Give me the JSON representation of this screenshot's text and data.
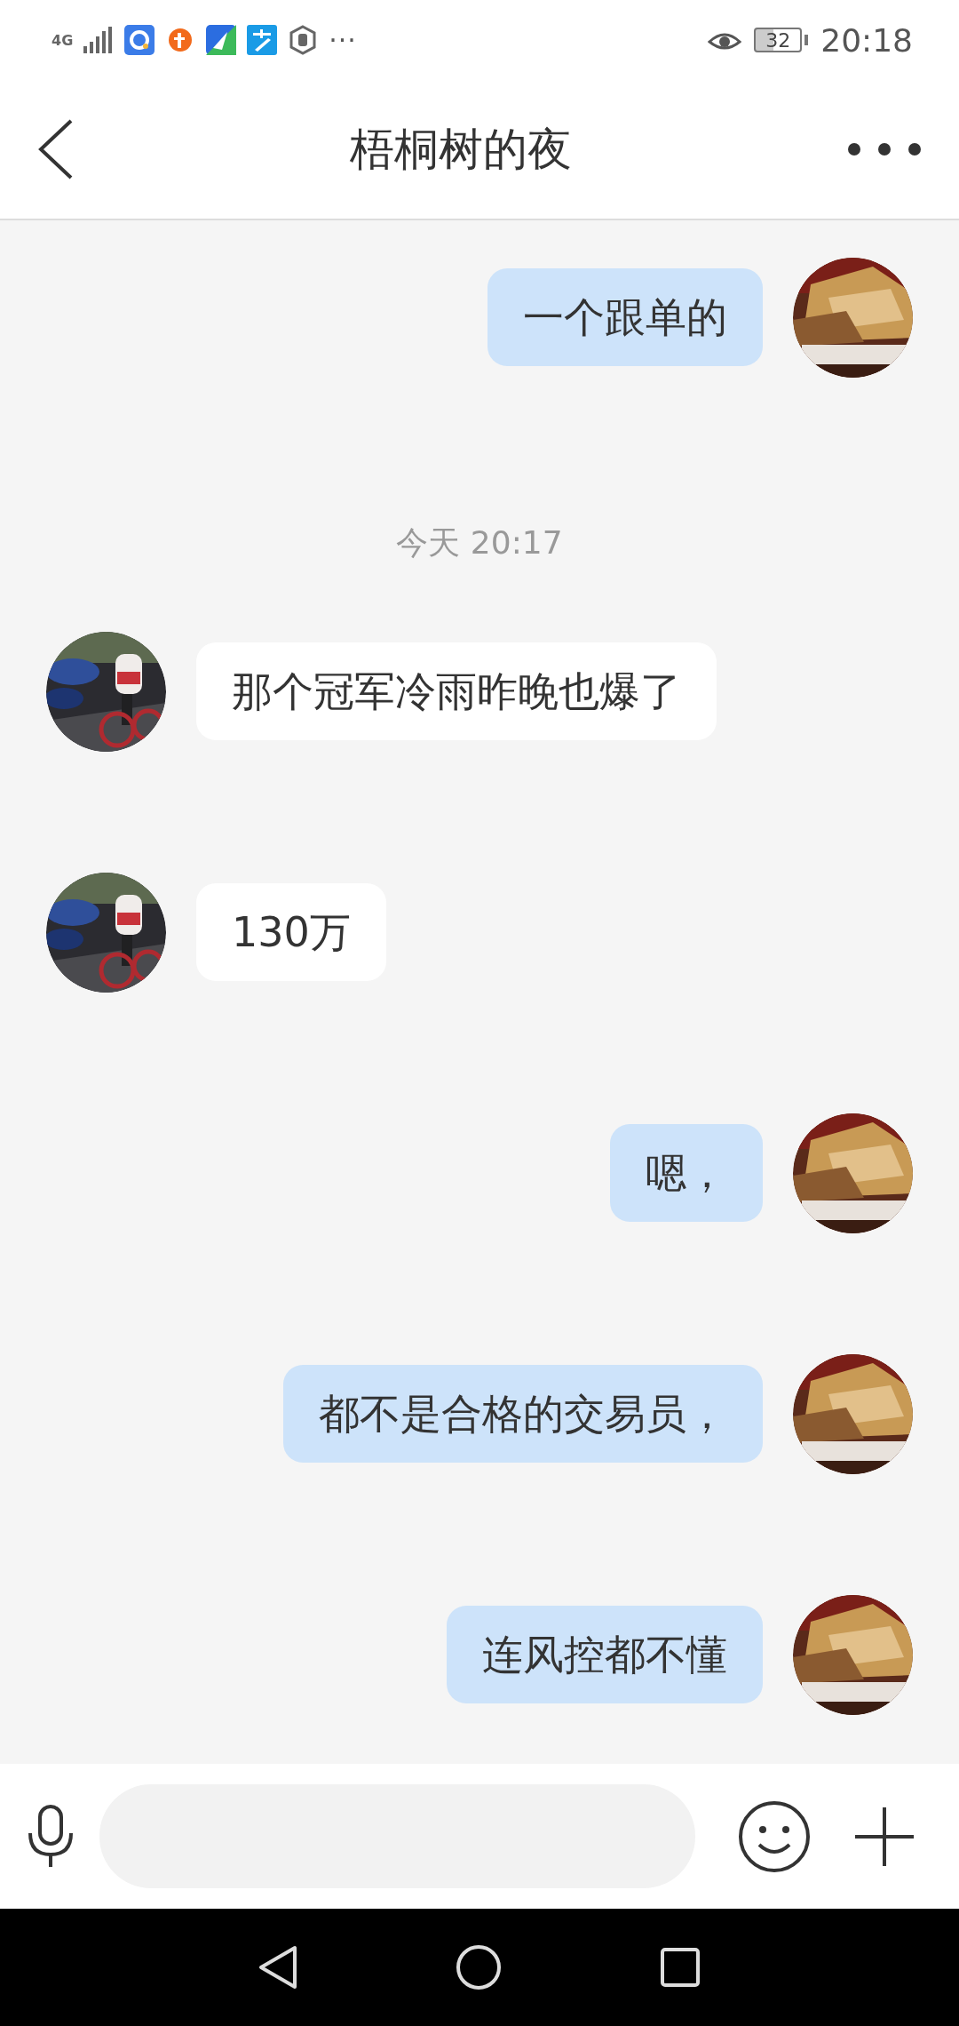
{
  "status_bar": {
    "network": "4G",
    "more": "···",
    "battery": "32",
    "time": "20:18"
  },
  "header": {
    "title": "梧桐树的夜"
  },
  "messages": [
    {
      "kind": "sent",
      "text": "一个跟单的"
    },
    {
      "kind": "time",
      "text": "今天 20:17"
    },
    {
      "kind": "received",
      "text": "那个冠军冷雨昨晚也爆了"
    },
    {
      "kind": "received",
      "text": "130万"
    },
    {
      "kind": "sent",
      "text": "嗯，"
    },
    {
      "kind": "sent",
      "text": "都不是合格的交易员，"
    },
    {
      "kind": "sent",
      "text": "连风控都不懂"
    }
  ]
}
